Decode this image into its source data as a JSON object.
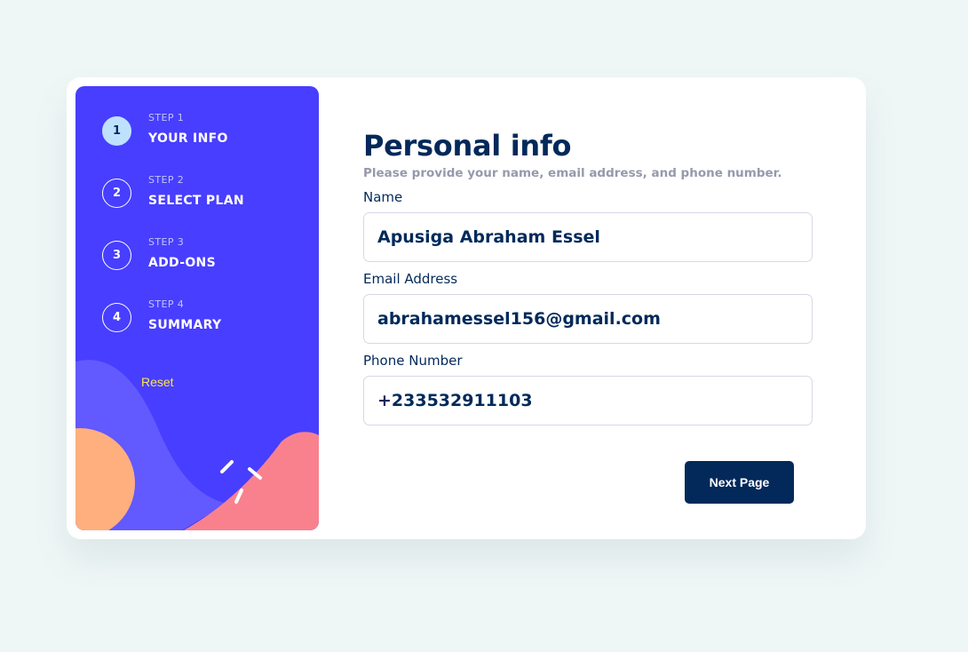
{
  "sidebar": {
    "steps": [
      {
        "number": "1",
        "label": "STEP 1",
        "title": "YOUR INFO",
        "active": true
      },
      {
        "number": "2",
        "label": "STEP 2",
        "title": "SELECT PLAN",
        "active": false
      },
      {
        "number": "3",
        "label": "STEP 3",
        "title": "ADD-ONS",
        "active": false
      },
      {
        "number": "4",
        "label": "STEP 4",
        "title": "SUMMARY",
        "active": false
      }
    ],
    "reset_label": "Reset"
  },
  "form": {
    "title": "Personal info",
    "subtitle": "Please provide your name, email address, and phone number.",
    "fields": {
      "name": {
        "label": "Name",
        "value": "Apusiga Abraham Essel"
      },
      "email": {
        "label": "Email Address",
        "value": "abrahamessel156@gmail.com"
      },
      "phone": {
        "label": "Phone Number",
        "value": "+233532911103"
      }
    },
    "next_label": "Next Page"
  },
  "colors": {
    "sidebar_bg": "#483eff",
    "active_step": "#bee2fd",
    "primary": "#02295a",
    "reset": "#ffe64d",
    "page_bg": "#eff7f6"
  }
}
